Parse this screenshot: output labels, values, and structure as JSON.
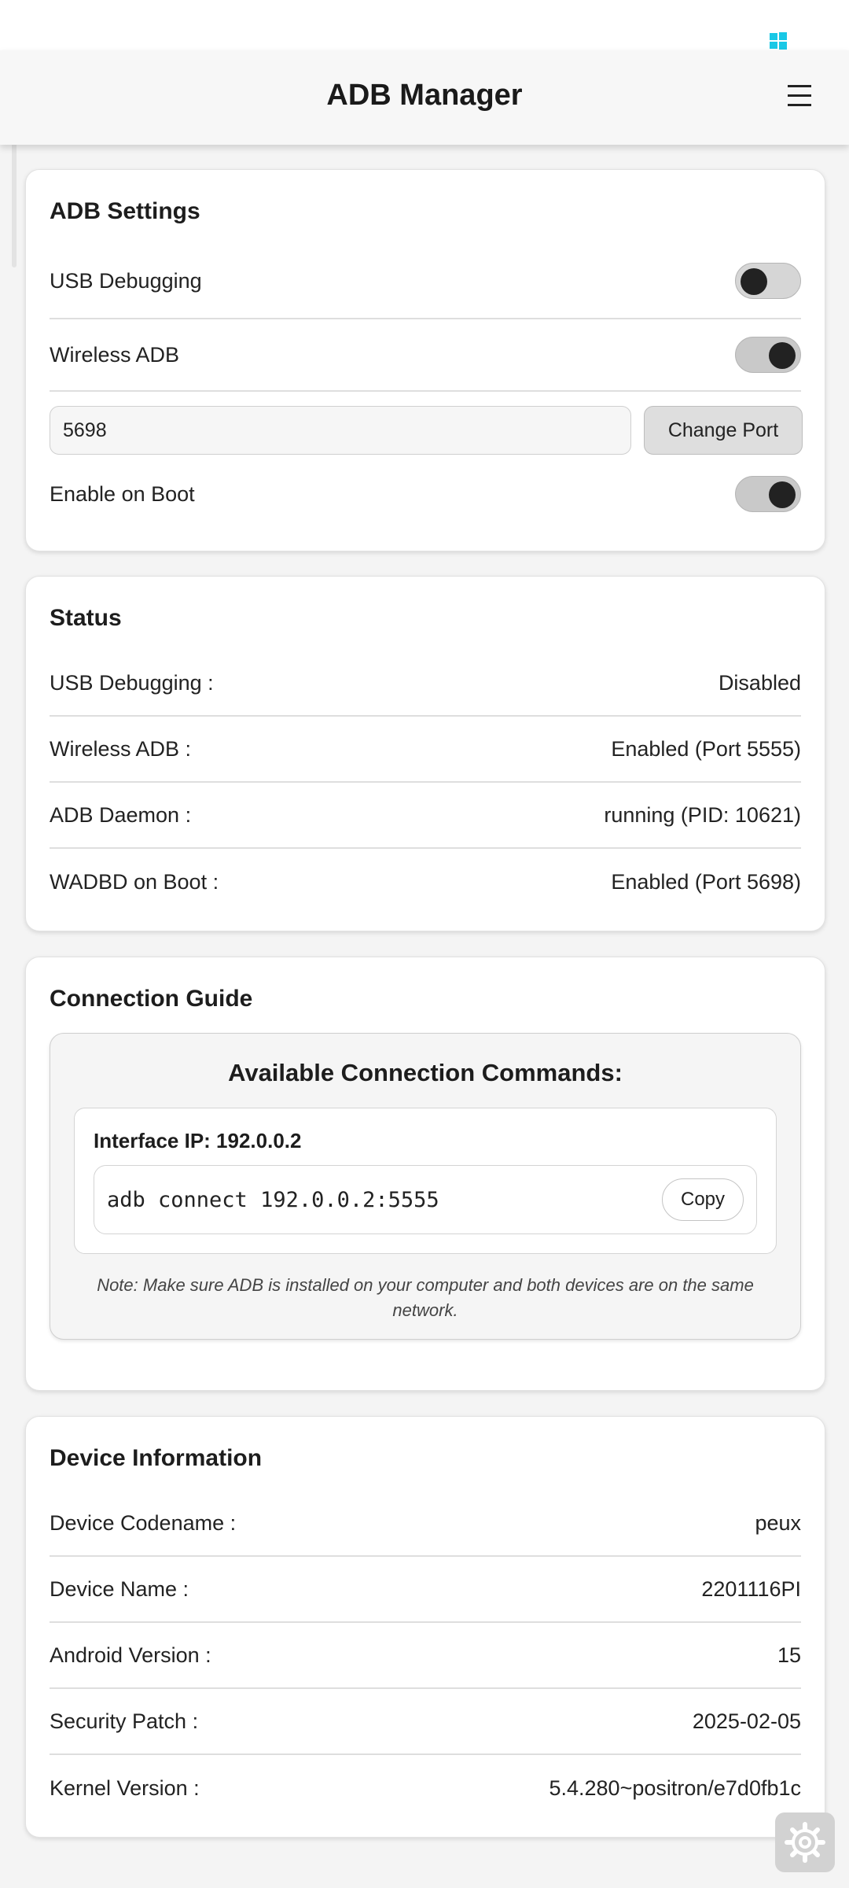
{
  "app": {
    "title": "ADB Manager"
  },
  "adb_settings": {
    "title": "ADB Settings",
    "usb_debugging_label": "USB Debugging",
    "usb_debugging_on": false,
    "wireless_adb_label": "Wireless ADB",
    "wireless_adb_on": true,
    "port_value": "5698",
    "change_port_label": "Change Port",
    "enable_on_boot_label": "Enable on Boot",
    "enable_on_boot_on": true
  },
  "status": {
    "title": "Status",
    "rows": [
      {
        "label": "USB Debugging :",
        "value": "Disabled"
      },
      {
        "label": "Wireless ADB :",
        "value": "Enabled (Port 5555)"
      },
      {
        "label": "ADB Daemon :",
        "value": "running (PID: 10621)"
      },
      {
        "label": "WADBD on Boot :",
        "value": "Enabled (Port 5698)"
      }
    ]
  },
  "connection_guide": {
    "title": "Connection Guide",
    "heading": "Available Connection Commands:",
    "interface_label": "Interface IP: 192.0.0.2",
    "command": "adb connect 192.0.0.2:5555",
    "copy_label": "Copy",
    "note": "Note: Make sure ADB is installed on your computer and both devices are on the same network."
  },
  "device_info": {
    "title": "Device Information",
    "rows": [
      {
        "label": "Device Codename :",
        "value": "peux"
      },
      {
        "label": "Device Name :",
        "value": "2201116PI"
      },
      {
        "label": "Android Version :",
        "value": "15"
      },
      {
        "label": "Security Patch :",
        "value": "2025-02-05"
      },
      {
        "label": "Kernel Version :",
        "value": "5.4.280~positron/e7d0fb1c"
      }
    ]
  },
  "icons": {
    "status_icon": "windows-logo-icon",
    "menu_icon": "hamburger-menu-icon",
    "fab_icon": "settings-gear-icon"
  },
  "colors": {
    "status_icon": "#19c8e6",
    "toggle_knob": "#222222",
    "card_bg": "#ffffff",
    "page_bg": "#f4f4f4"
  }
}
